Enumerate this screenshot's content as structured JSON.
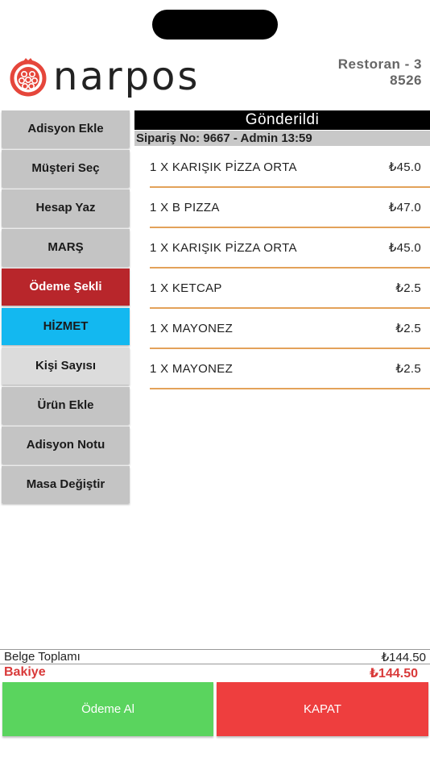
{
  "header": {
    "logo_text": "narpos",
    "restaurant": "Restoran - 3",
    "table_number": "8526"
  },
  "sidebar": {
    "items": [
      {
        "label": "Adisyon Ekle"
      },
      {
        "label": "Müşteri Seç"
      },
      {
        "label": "Hesap Yaz"
      },
      {
        "label": "MARŞ"
      },
      {
        "label": "Ödeme Şekli"
      },
      {
        "label": "HİZMET"
      },
      {
        "label": "Kişi Sayısı"
      },
      {
        "label": "Ürün Ekle"
      },
      {
        "label": "Adisyon Notu"
      },
      {
        "label": "Masa Değiştir"
      }
    ]
  },
  "order": {
    "status": "Gönderildi",
    "info": "Sipariş No: 9667 - Admin 13:59",
    "items": [
      {
        "name": "1 X KARIŞIK PİZZA ORTA",
        "price": "₺45.0"
      },
      {
        "name": "1 X B PIZZA",
        "price": "₺47.0"
      },
      {
        "name": "1 X KARIŞIK PİZZA ORTA",
        "price": "₺45.0"
      },
      {
        "name": "1 X KETCAP",
        "price": "₺2.5"
      },
      {
        "name": "1 X MAYONEZ",
        "price": "₺2.5"
      },
      {
        "name": "1 X MAYONEZ",
        "price": "₺2.5"
      }
    ]
  },
  "totals": {
    "doc_label": "Belge Toplamı",
    "doc_amount": "₺144.50",
    "balance_label": "Bakiye",
    "balance_amount": "₺144.50"
  },
  "actions": {
    "pay_label": "Ödeme Al",
    "close_label": "KAPAT"
  },
  "colors": {
    "brand_red": "#e5463b",
    "pay_green": "#5ad45e",
    "close_red": "#ee3e3e",
    "accent_orange": "#e3a25a",
    "payment_method_red": "#b8262b",
    "service_cyan": "#13b8f0"
  }
}
